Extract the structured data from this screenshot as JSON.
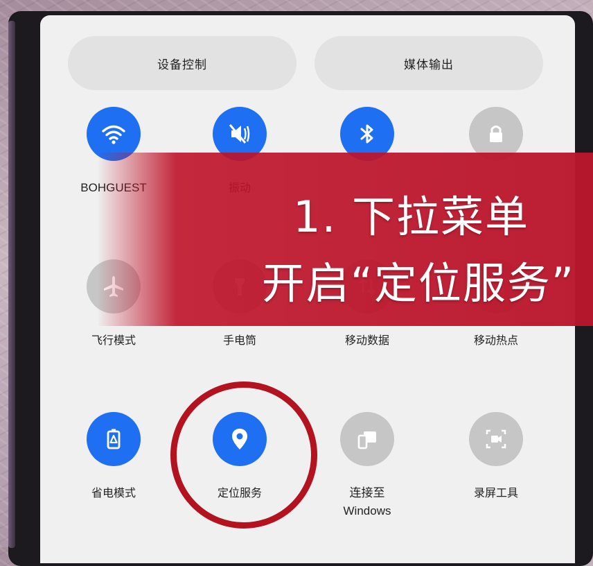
{
  "panel": {
    "device_control_label": "设备控制",
    "media_output_label": "媒体输出"
  },
  "tiles": {
    "wifi": {
      "label": "BOHGUEST",
      "state": "on",
      "icon": "wifi-icon"
    },
    "sound": {
      "label": "振动",
      "state": "on",
      "icon": "mute-icon"
    },
    "bluetooth": {
      "label": "",
      "state": "on",
      "icon": "bluetooth-icon"
    },
    "lock": {
      "label": "",
      "state": "off",
      "icon": "lock-icon"
    },
    "airplane": {
      "label": "飞行模式",
      "state": "off",
      "icon": "airplane-icon"
    },
    "flashlight": {
      "label": "手电筒",
      "state": "off",
      "icon": "flashlight-icon"
    },
    "mobile_data": {
      "label": "移动数据",
      "state": "off",
      "icon": "mobile-data-icon"
    },
    "hotspot": {
      "label": "移动热点",
      "state": "off",
      "icon": "hotspot-icon"
    },
    "power_saving": {
      "label": "省电模式",
      "state": "on",
      "icon": "battery-icon"
    },
    "location": {
      "label": "定位服务",
      "state": "on",
      "icon": "location-pin-icon"
    },
    "link_windows": {
      "label": "连接至\nWindows",
      "state": "off",
      "icon": "link-to-windows-icon"
    },
    "screen_record": {
      "label": "录屏工具",
      "state": "off",
      "icon": "screen-record-icon"
    }
  },
  "overlay": {
    "line1": "1. 下拉菜单",
    "line2": "开启“定位服务”"
  },
  "colors": {
    "active": "#1f6ff2",
    "inactive": "#c6c6c6",
    "banner": "#bb162c",
    "ring": "#b3121f"
  }
}
